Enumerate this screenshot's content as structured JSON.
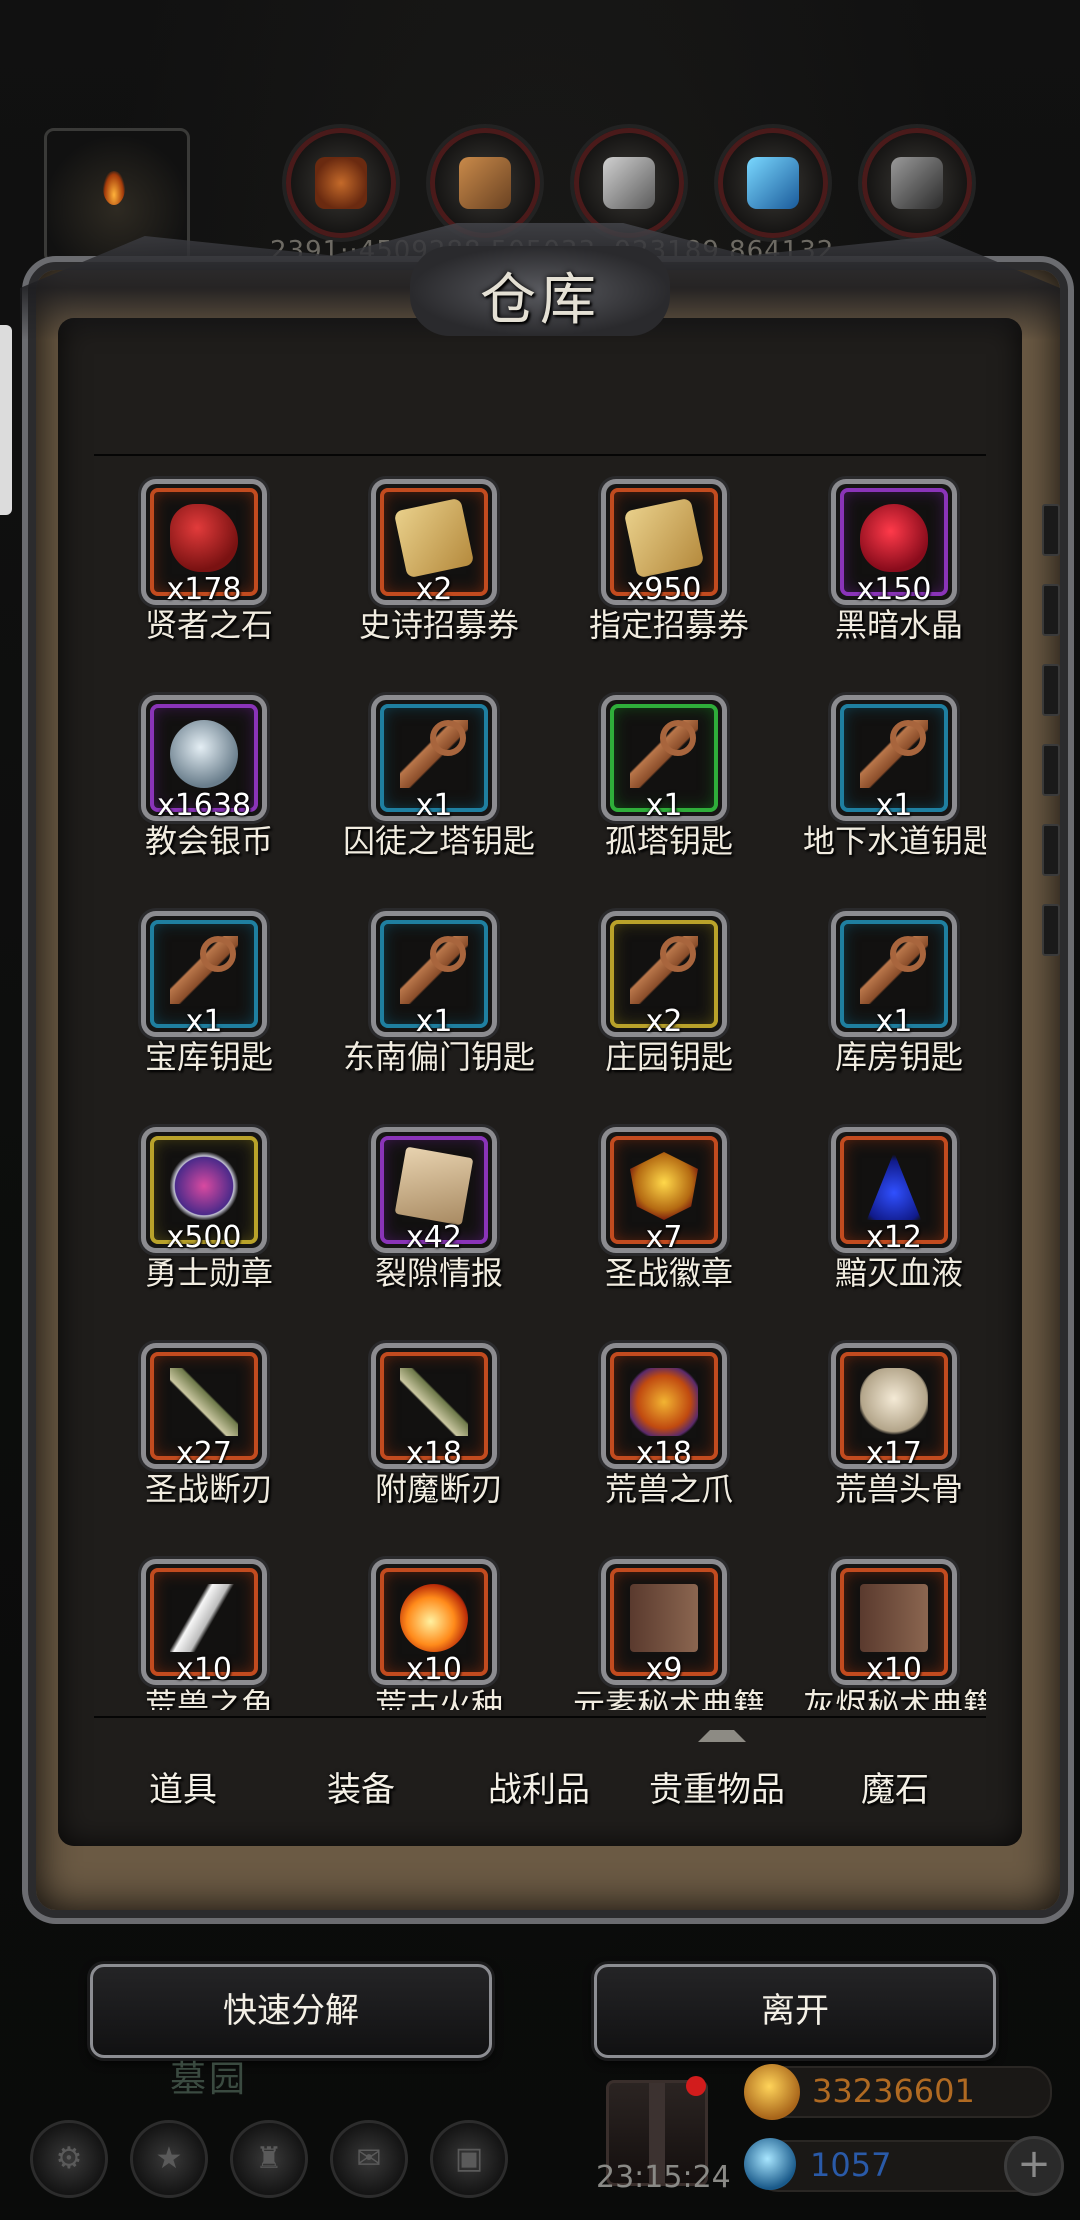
{
  "resources": {
    "values_text": "2391··4509288 505033··923189 864132",
    "icons": [
      "meat-icon",
      "wood-icon",
      "iron-icon",
      "crystal-icon",
      "ore-icon"
    ]
  },
  "window": {
    "title": "仓库"
  },
  "items": [
    {
      "name": "贤者之石",
      "count": "x178",
      "rarity": "red",
      "icon": "stone-icon"
    },
    {
      "name": "史诗招募券",
      "count": "x2",
      "rarity": "red",
      "icon": "scroll-icon"
    },
    {
      "name": "指定招募券",
      "count": "x950",
      "rarity": "red",
      "icon": "scroll-icon"
    },
    {
      "name": "黑暗水晶",
      "count": "x150",
      "rarity": "purple",
      "icon": "crystal-icon"
    },
    {
      "name": "教会银币",
      "count": "x1638",
      "rarity": "purple",
      "icon": "coin-icon"
    },
    {
      "name": "囚徒之塔钥匙",
      "count": "x1",
      "rarity": "blue",
      "icon": "key-icon"
    },
    {
      "name": "孤塔钥匙",
      "count": "x1",
      "rarity": "green",
      "icon": "key-icon"
    },
    {
      "name": "地下水道钥匙",
      "count": "x1",
      "rarity": "blue",
      "icon": "key-icon"
    },
    {
      "name": "宝库钥匙",
      "count": "x1",
      "rarity": "blue",
      "icon": "key-icon"
    },
    {
      "name": "东南偏门钥匙",
      "count": "x1",
      "rarity": "blue",
      "icon": "key-icon"
    },
    {
      "name": "庄园钥匙",
      "count": "x2",
      "rarity": "gold",
      "icon": "key-icon"
    },
    {
      "name": "库房钥匙",
      "count": "x1",
      "rarity": "blue",
      "icon": "key-icon"
    },
    {
      "name": "勇士勋章",
      "count": "x500",
      "rarity": "gold",
      "icon": "medal-icon"
    },
    {
      "name": "裂隙情报",
      "count": "x42",
      "rarity": "purple",
      "icon": "paper-icon"
    },
    {
      "name": "圣战徽章",
      "count": "x7",
      "rarity": "red",
      "icon": "badge-icon"
    },
    {
      "name": "黯灭血液",
      "count": "x12",
      "rarity": "red",
      "icon": "blood-icon"
    },
    {
      "name": "圣战断刃",
      "count": "x27",
      "rarity": "red",
      "icon": "blade-icon"
    },
    {
      "name": "附魔断刃",
      "count": "x18",
      "rarity": "red",
      "icon": "blade-icon"
    },
    {
      "name": "荒兽之爪",
      "count": "x18",
      "rarity": "red",
      "icon": "claw-icon"
    },
    {
      "name": "荒兽头骨",
      "count": "x17",
      "rarity": "red",
      "icon": "skull-icon"
    },
    {
      "name": "荒兽之角",
      "count": "x10",
      "rarity": "red",
      "icon": "horn-icon"
    },
    {
      "name": "荒古火种",
      "count": "x10",
      "rarity": "red",
      "icon": "fire-icon"
    },
    {
      "name": "元素秘术典籍",
      "count": "x9",
      "rarity": "red",
      "icon": "book-icon"
    },
    {
      "name": "灰烬秘术典籍",
      "count": "x10",
      "rarity": "red",
      "icon": "book-icon"
    }
  ],
  "tabs": [
    "道具",
    "装备",
    "战利品",
    "贵重物品",
    "魔石"
  ],
  "buttons": {
    "quick_decompose": "快速分解",
    "leave": "离开"
  },
  "footer": {
    "location": "墓园",
    "timer": "23:15:24",
    "gold": "33236601",
    "gems": "1057"
  },
  "colors": {
    "rarity_red": "#c24b1f",
    "rarity_blue": "#1f7fa0",
    "rarity_green": "#2fae3a",
    "rarity_purple": "#8a34b8",
    "rarity_gold": "#b9a22a",
    "gold_text": "#b06a22",
    "gem_text": "#2a5aa8"
  }
}
